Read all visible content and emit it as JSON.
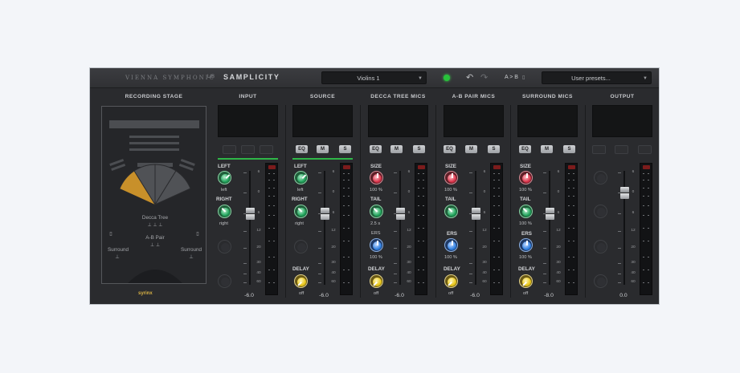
{
  "header": {
    "brand": "VIENNA SYMPHONIC",
    "brand_small": "LIB",
    "product": "SAMPLICITY",
    "preset_combo": "Violins 1",
    "ab_label": "A > B",
    "user_presets": "User presets...",
    "undo_icon": "undo-icon",
    "redo_icon": "redo-icon",
    "status_led_color": "#27c23a"
  },
  "stage": {
    "title": "RECORDING STAGE",
    "labels": {
      "decca_tree": "Decca Tree",
      "ab_pair": "A-B Pair",
      "surround_left": "Surround",
      "surround_right": "Surround"
    },
    "logo": "syrinx",
    "accent_color": "#c8902a"
  },
  "channels": [
    {
      "title": "INPUT",
      "fader_value": "-6.0",
      "p1": {
        "label": "LEFT",
        "value": "left"
      },
      "p2": {
        "label": "RIGHT",
        "value": "right"
      }
    },
    {
      "title": "SOURCE",
      "fader_value": "-6.0",
      "p1": {
        "label": "LEFT",
        "value": "left"
      },
      "p2": {
        "label": "RIGHT",
        "value": "right"
      },
      "delay": {
        "label": "DELAY",
        "value": "off"
      },
      "buttons": [
        "EQ",
        "M",
        "S"
      ]
    },
    {
      "title": "DECCA TREE MICS",
      "fader_value": "-6.0",
      "p1": {
        "label": "SIZE",
        "value": "100 %"
      },
      "p2": {
        "label": "TAIL",
        "value": "2.5 s"
      },
      "p3": {
        "label": "",
        "value": "100 %"
      },
      "p3_top": "ERS",
      "delay": {
        "label": "DELAY",
        "value": "off"
      },
      "buttons": [
        "EQ",
        "M",
        "S"
      ]
    },
    {
      "title": "A-B PAIR MICS",
      "fader_value": "-6.0",
      "p1": {
        "label": "SIZE",
        "value": "100 %"
      },
      "p2": {
        "label": "TAIL",
        "value": ""
      },
      "p3": {
        "label": "ERS",
        "value": "100 %"
      },
      "delay": {
        "label": "DELAY",
        "value": "off"
      },
      "buttons": [
        "EQ",
        "M",
        "S"
      ]
    },
    {
      "title": "SURROUND MICS",
      "fader_value": "-8.0",
      "p1": {
        "label": "SIZE",
        "value": "100 %"
      },
      "p2": {
        "label": "TAIL",
        "value": "100 %"
      },
      "p3": {
        "label": "ERS",
        "value": "100 %"
      },
      "delay": {
        "label": "DELAY",
        "value": "off"
      },
      "buttons": [
        "EQ",
        "M",
        "S"
      ]
    },
    {
      "title": "OUTPUT",
      "fader_value": "0.0"
    }
  ],
  "fader_scale": [
    "6",
    "0",
    "6",
    "12",
    "20",
    "30",
    "40",
    "60"
  ]
}
